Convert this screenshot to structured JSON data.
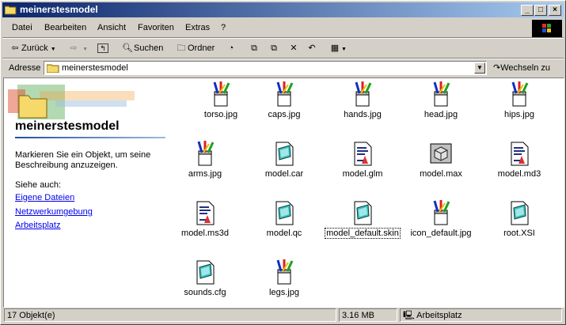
{
  "window": {
    "title": "meinerstesmodel"
  },
  "menu": [
    "Datei",
    "Bearbeiten",
    "Ansicht",
    "Favoriten",
    "Extras",
    "?"
  ],
  "toolbar": {
    "back": "Zurück",
    "search": "Suchen",
    "folders": "Ordner"
  },
  "address": {
    "label": "Adresse",
    "value": "meinerstesmodel",
    "go": "Wechseln zu"
  },
  "sidebar": {
    "title": "meinerstesmodel",
    "description": "Markieren Sie ein Objekt, um seine Beschreibung anzuzeigen.",
    "see_also": "Siehe auch:",
    "links": [
      "Eigene Dateien",
      "Netzwerkumgebung",
      "Arbeitsplatz"
    ]
  },
  "files": [
    {
      "name": "torso.jpg",
      "icon": "jpg-paint-icon"
    },
    {
      "name": "caps.jpg",
      "icon": "jpg-paint-icon"
    },
    {
      "name": "hands.jpg",
      "icon": "jpg-paint-icon"
    },
    {
      "name": "head.jpg",
      "icon": "jpg-paint-icon"
    },
    {
      "name": "hips.jpg",
      "icon": "jpg-paint-icon"
    },
    {
      "name": "arms.jpg",
      "icon": "jpg-paint-icon"
    },
    {
      "name": "model.car",
      "icon": "generic-file-icon"
    },
    {
      "name": "model.glm",
      "icon": "document-icon"
    },
    {
      "name": "model.max",
      "icon": "max-cube-icon"
    },
    {
      "name": "model.md3",
      "icon": "document-icon"
    },
    {
      "name": "model.ms3d",
      "icon": "document-icon"
    },
    {
      "name": "model.qc",
      "icon": "generic-file-icon"
    },
    {
      "name": "model_default.skin",
      "icon": "generic-file-icon"
    },
    {
      "name": "icon_default.jpg",
      "icon": "jpg-paint-icon"
    },
    {
      "name": "root.XSI",
      "icon": "generic-file-icon"
    },
    {
      "name": "sounds.cfg",
      "icon": "generic-file-icon"
    },
    {
      "name": "legs.jpg",
      "icon": "jpg-paint-icon"
    }
  ],
  "status": {
    "count": "17 Objekt(e)",
    "size": "3.16 MB",
    "zone": "Arbeitsplatz"
  }
}
